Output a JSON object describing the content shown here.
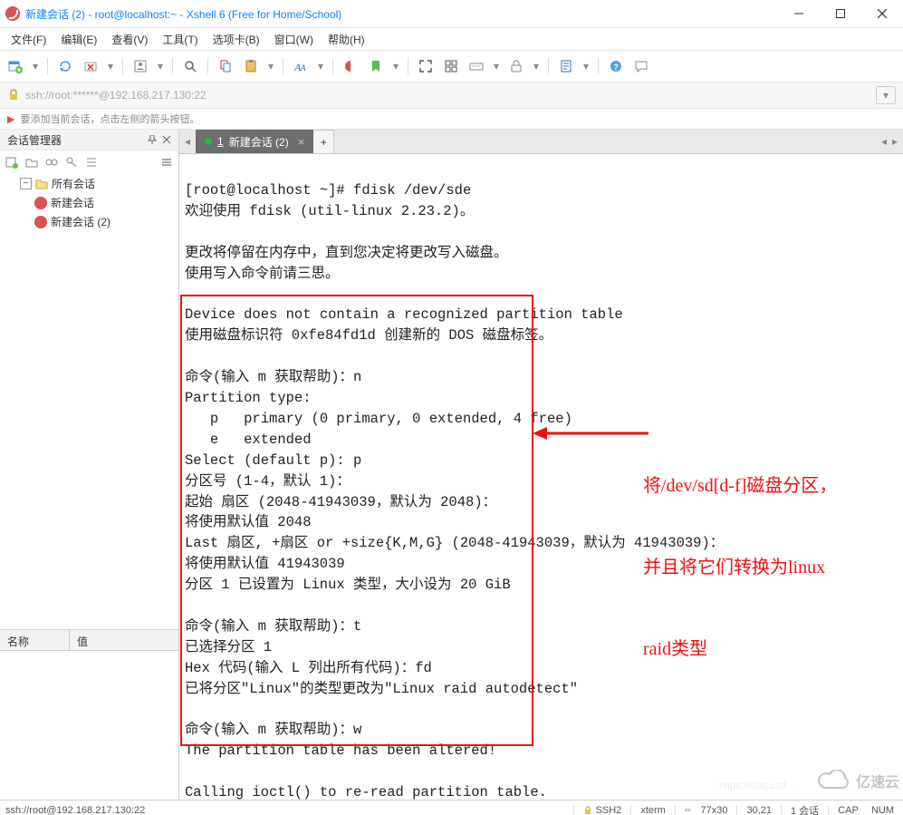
{
  "window": {
    "title": "新建会话 (2) - root@localhost:~ - Xshell 6 (Free for Home/School)"
  },
  "menu": {
    "file": "文件(F)",
    "edit": "编辑(E)",
    "view": "查看(V)",
    "tools": "工具(T)",
    "tabs": "选项卡(B)",
    "window": "窗口(W)",
    "help": "帮助(H)"
  },
  "addressbar": {
    "text": "ssh://root:******@192.168.217.130:22"
  },
  "hint": {
    "text": "要添加当前会话，点击左侧的箭头按钮。"
  },
  "sidebar": {
    "title": "会话管理器",
    "root": "所有会话",
    "items": [
      "新建会话",
      "新建会话 (2)"
    ],
    "prop_name": "名称",
    "prop_value": "值"
  },
  "tabs": {
    "t1_index": "1",
    "t1_label": "新建会话 (2)"
  },
  "terminal": {
    "content": "[root@localhost ~]# fdisk /dev/sde\n欢迎使用 fdisk (util-linux 2.23.2)。\n\n更改将停留在内存中，直到您决定将更改写入磁盘。\n使用写入命令前请三思。\n\nDevice does not contain a recognized partition table\n使用磁盘标识符 0xfe84fd1d 创建新的 DOS 磁盘标签。\n\n命令(输入 m 获取帮助)：n\nPartition type:\n   p   primary (0 primary, 0 extended, 4 free)\n   e   extended\nSelect (default p): p\n分区号 (1-4，默认 1)：\n起始 扇区 (2048-41943039，默认为 2048)：\n将使用默认值 2048\nLast 扇区, +扇区 or +size{K,M,G} (2048-41943039，默认为 41943039)：\n将使用默认值 41943039\n分区 1 已设置为 Linux 类型，大小设为 20 GiB\n\n命令(输入 m 获取帮助)：t\n已选择分区 1\nHex 代码(输入 L 列出所有代码)：fd\n已将分区\"Linux\"的类型更改为\"Linux raid autodetect\"\n\n命令(输入 m 获取帮助)：w\nThe partition table has been altered!\n\nCalling ioctl() to re-read partition table."
  },
  "annotation": {
    "l1": "将/dev/sd[d-f]磁盘分区，",
    "l2": "并且将它们转换为linux",
    "l3": "raid类型"
  },
  "status": {
    "left": "ssh://root@192.168.217.130:22",
    "proto": "SSH2",
    "term": "xterm",
    "size": "77x30",
    "pos": "30,21",
    "sessions": "1 会话",
    "cap": "CAP",
    "num": "NUM"
  },
  "watermark": {
    "brand": "亿速云",
    "ghost": "https://blog.csd..."
  },
  "colors": {
    "accent_red": "#e11",
    "tab_bg": "#6d6d6d",
    "green_dot": "#26b83f",
    "title_blue": "#0a84ff"
  }
}
